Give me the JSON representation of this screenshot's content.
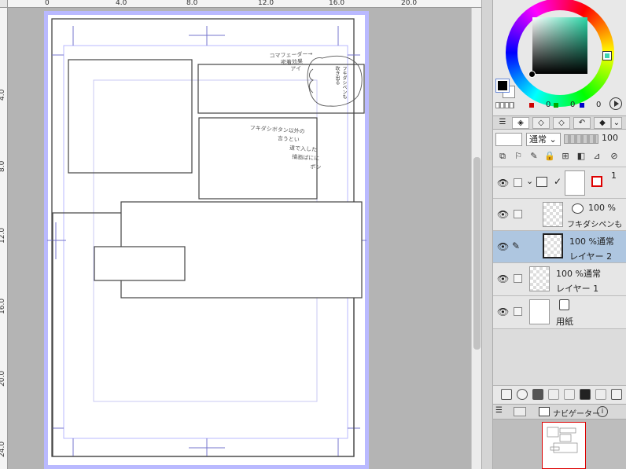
{
  "rulers": {
    "top_labels": [
      "0",
      "4.0",
      "8.0",
      "12.0",
      "16.0",
      "20.0"
    ],
    "left_labels": [
      "4.0",
      "8.0",
      "12.0",
      "16.0",
      "20.0",
      "24.0"
    ]
  },
  "canvas": {
    "annotations": {
      "note_1_line_1": "コマフェーダー→",
      "note_1_line_2": "密着効果",
      "note_1_line_3": "アイ",
      "bubble_text": "フキダシペンも\n吹き出る",
      "note_2_line_1": "フキダシボタン以外の",
      "note_2_line_2": "言うとい",
      "note_2_line_3": "道で入した",
      "note_2_line_4": "描画ばにに",
      "note_2_line_5": "ボン"
    }
  },
  "color_panel": {
    "main_color": "#000000",
    "sub_color": "#ffffff",
    "r": "0",
    "g": "0",
    "b": "0"
  },
  "layer_toolbar": {
    "blend_mode": "通常",
    "opacity": "100"
  },
  "layers": [
    {
      "id": "folder",
      "name": "",
      "opacity": "1"
    },
    {
      "id": "balloon",
      "name": "フキダシペンも",
      "opacity": "100 %"
    },
    {
      "id": "layer2",
      "name": "レイヤー 2",
      "opacity": "100 %通常"
    },
    {
      "id": "layer1",
      "name": "レイヤー 1",
      "opacity": "100 %通常"
    },
    {
      "id": "paper",
      "name": "用紙",
      "opacity": ""
    }
  ],
  "navigator": {
    "tab_label": "ナビゲーター"
  },
  "colors": {
    "selection_blue": "#aec6e0",
    "page_border": "#b9b9ff",
    "guide_line": "#8a8ad8"
  }
}
